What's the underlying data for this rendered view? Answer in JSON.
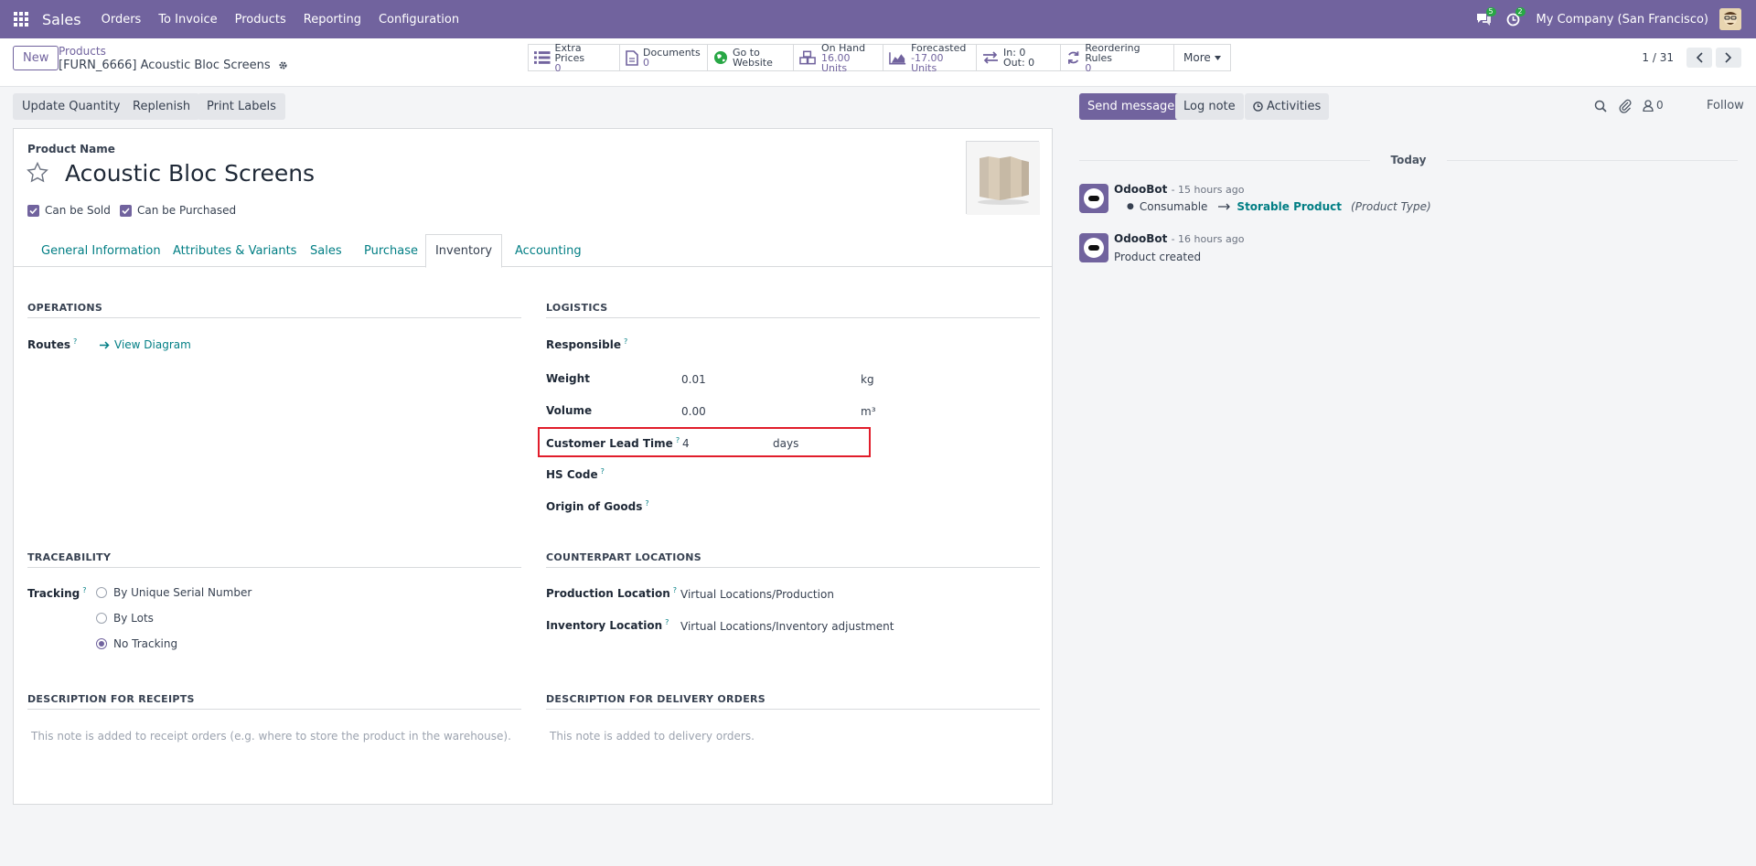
{
  "topnav": {
    "app_name": "Sales",
    "menus": [
      "Orders",
      "To Invoice",
      "Products",
      "Reporting",
      "Configuration"
    ],
    "chat_badge": "5",
    "activity_badge": "2",
    "company": "My Company (San Francisco)"
  },
  "control_panel": {
    "new_label": "New",
    "breadcrumb_parent": "Products",
    "breadcrumb_current": "[FURN_6666] Acoustic Bloc Screens",
    "smart_buttons": {
      "extra_prices": {
        "label": "Extra Prices",
        "value": "0"
      },
      "documents": {
        "label": "Documents",
        "value": "0"
      },
      "website": {
        "label": "Go to",
        "value": "Website"
      },
      "on_hand": {
        "label": "On Hand",
        "value": "16.00 Units"
      },
      "forecasted": {
        "label": "Forecasted",
        "value": "-17.00 Units"
      },
      "in_out": {
        "label": "In: 0",
        "value": "Out: 0"
      },
      "reordering": {
        "label": "Reordering Rules",
        "value": "0"
      },
      "more": "More"
    },
    "pager": "1 / 31"
  },
  "actions": {
    "update_quantity": "Update Quantity",
    "replenish": "Replenish",
    "print_labels": "Print Labels"
  },
  "chatter": {
    "send_message": "Send message",
    "log_note": "Log note",
    "activities": "Activities",
    "followers_count": "0",
    "follow": "Follow",
    "today": "Today",
    "messages": [
      {
        "author": "OdooBot",
        "time": "- 15 hours ago",
        "old_value": "Consumable",
        "new_value": "Storable Product",
        "field": "(Product Type)"
      },
      {
        "author": "OdooBot",
        "time": "- 16 hours ago",
        "body": "Product created"
      }
    ]
  },
  "form": {
    "product_name_label": "Product Name",
    "product_name": "Acoustic Bloc Screens",
    "can_be_sold": "Can be Sold",
    "can_be_purchased": "Can be Purchased",
    "tabs": [
      "General Information",
      "Attributes & Variants",
      "Sales",
      "Purchase",
      "Inventory",
      "Accounting"
    ],
    "operations": {
      "title": "OPERATIONS",
      "routes_label": "Routes",
      "view_diagram": "View Diagram"
    },
    "logistics": {
      "title": "LOGISTICS",
      "responsible_label": "Responsible",
      "weight_label": "Weight",
      "weight_value": "0.01",
      "weight_unit": "kg",
      "volume_label": "Volume",
      "volume_value": "0.00",
      "volume_unit": "m³",
      "lead_time_label": "Customer Lead Time",
      "lead_time_value": "4",
      "lead_time_unit": "days",
      "hs_code_label": "HS Code",
      "origin_label": "Origin of Goods"
    },
    "traceability": {
      "title": "TRACEABILITY",
      "tracking_label": "Tracking",
      "options": [
        "By Unique Serial Number",
        "By Lots",
        "No Tracking"
      ],
      "selected": "No Tracking"
    },
    "counterpart": {
      "title": "COUNTERPART LOCATIONS",
      "production_label": "Production Location",
      "production_value": "Virtual Locations/Production",
      "inventory_label": "Inventory Location",
      "inventory_value": "Virtual Locations/Inventory adjustment"
    },
    "receipts": {
      "title": "DESCRIPTION FOR RECEIPTS",
      "placeholder": "This note is added to receipt orders (e.g. where to store the product in the warehouse)."
    },
    "delivery": {
      "title": "DESCRIPTION FOR DELIVERY ORDERS",
      "placeholder": "This note is added to delivery orders."
    }
  },
  "colors": {
    "brand": "#71639e",
    "link": "#017e84",
    "highlight": "#e11d2b"
  }
}
